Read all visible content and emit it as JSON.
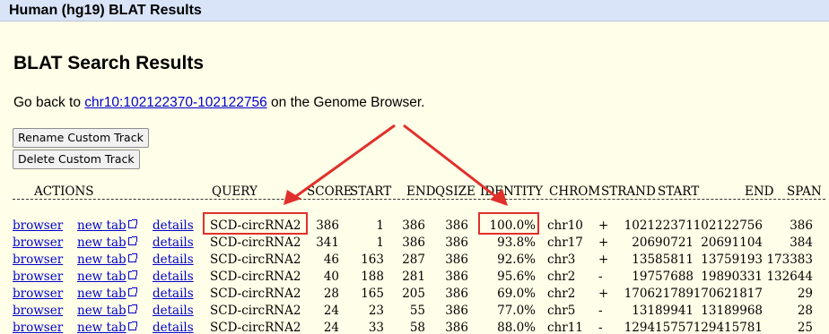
{
  "header": {
    "title": "Human (hg19) BLAT Results"
  },
  "page": {
    "heading": "BLAT Search Results",
    "goback_prefix": "Go back to",
    "goback_link": "chr10:102122370-102122756",
    "goback_suffix": "on the Genome Browser."
  },
  "buttons": {
    "rename": "Rename Custom Track",
    "delete": "Delete Custom Track"
  },
  "table": {
    "headers": {
      "actions": "ACTIONS",
      "query": "QUERY",
      "score": "SCORE",
      "start": "START",
      "end": "END",
      "qsize": "QSIZE",
      "identity": "IDENTITY",
      "chrom": "CHROM",
      "strand": "STRAND",
      "tstart": "START",
      "tend": "END",
      "span": "SPAN"
    },
    "link_labels": {
      "browser": "browser",
      "new_tab": "new tab",
      "details": "details"
    },
    "rows": [
      {
        "query": "SCD-circRNA2",
        "score": "386",
        "start": "1",
        "end": "386",
        "qsize": "386",
        "identity": "100.0%",
        "chrom": "chr10",
        "strand": "+",
        "tstart": "102122371",
        "tend": "102122756",
        "span": "386"
      },
      {
        "query": "SCD-circRNA2",
        "score": "341",
        "start": "1",
        "end": "386",
        "qsize": "386",
        "identity": "93.8%",
        "chrom": "chr17",
        "strand": "+",
        "tstart": "20690721",
        "tend": "20691104",
        "span": "384"
      },
      {
        "query": "SCD-circRNA2",
        "score": "46",
        "start": "163",
        "end": "287",
        "qsize": "386",
        "identity": "92.6%",
        "chrom": "chr3",
        "strand": "+",
        "tstart": "13585811",
        "tend": "13759193",
        "span": "173383"
      },
      {
        "query": "SCD-circRNA2",
        "score": "40",
        "start": "188",
        "end": "281",
        "qsize": "386",
        "identity": "95.6%",
        "chrom": "chr2",
        "strand": "-",
        "tstart": "19757688",
        "tend": "19890331",
        "span": "132644"
      },
      {
        "query": "SCD-circRNA2",
        "score": "28",
        "start": "165",
        "end": "205",
        "qsize": "386",
        "identity": "69.0%",
        "chrom": "chr2",
        "strand": "+",
        "tstart": "170621789",
        "tend": "170621817",
        "span": "29"
      },
      {
        "query": "SCD-circRNA2",
        "score": "24",
        "start": "23",
        "end": "55",
        "qsize": "386",
        "identity": "77.0%",
        "chrom": "chr5",
        "strand": "-",
        "tstart": "13189941",
        "tend": "13189968",
        "span": "28"
      },
      {
        "query": "SCD-circRNA2",
        "score": "24",
        "start": "33",
        "end": "58",
        "qsize": "386",
        "identity": "88.0%",
        "chrom": "chr11",
        "strand": "-",
        "tstart": "129415757",
        "tend": "129415781",
        "span": "25"
      }
    ]
  },
  "colors": {
    "annotation": "#E0302C",
    "link": "#0000CC",
    "page_bg": "#FFFEE8",
    "titlebar_bg": "#D9E4F8"
  },
  "icons": [
    "external-link-icon"
  ]
}
